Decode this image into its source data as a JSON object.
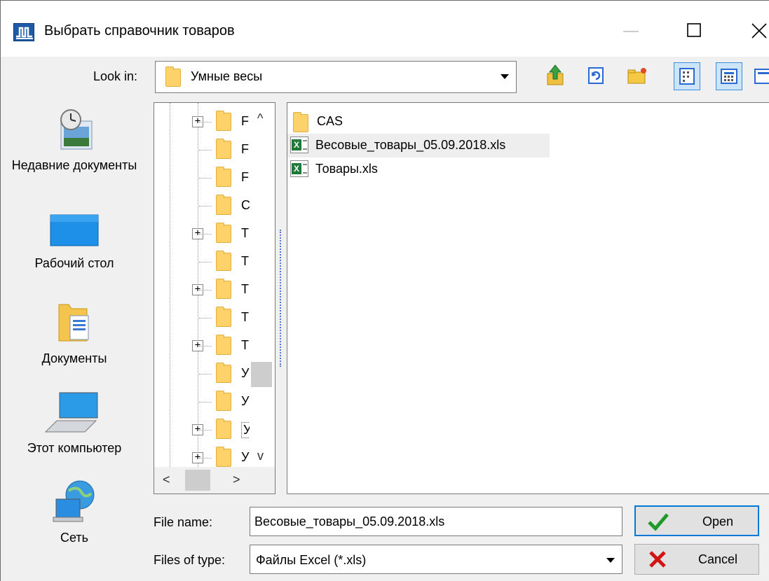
{
  "window": {
    "title": "Выбрать справочник товаров",
    "minimize_glyph": "—",
    "maximize_glyph": "☐",
    "close_glyph": "✕"
  },
  "lookin": {
    "label": "Look in:",
    "value": "Умные весы"
  },
  "toolbar": {
    "icons": [
      "up-folder-icon",
      "refresh-icon",
      "new-folder-icon",
      "list-view-icon",
      "details-view-icon"
    ]
  },
  "places": [
    {
      "label": "Недавние документы",
      "icon": "recent-documents-icon"
    },
    {
      "label": "Рабочий стол",
      "icon": "desktop-icon"
    },
    {
      "label": "Документы",
      "icon": "documents-icon"
    },
    {
      "label": "Этот компьютер",
      "icon": "computer-icon"
    },
    {
      "label": "Сеть",
      "icon": "network-icon"
    }
  ],
  "tree": {
    "items": [
      {
        "label": "F",
        "expandable": true
      },
      {
        "label": "F",
        "expandable": false
      },
      {
        "label": "F",
        "expandable": false
      },
      {
        "label": "C",
        "expandable": false
      },
      {
        "label": "T",
        "expandable": true
      },
      {
        "label": "T",
        "expandable": false
      },
      {
        "label": "T",
        "expandable": true
      },
      {
        "label": "T",
        "expandable": false
      },
      {
        "label": "T",
        "expandable": true
      },
      {
        "label": "У",
        "expandable": false
      },
      {
        "label": "У",
        "expandable": false
      },
      {
        "label": "У",
        "expandable": true
      },
      {
        "label": "У",
        "expandable": true
      }
    ],
    "scroll_up": "^",
    "scroll_down": "v",
    "scroll_left": "<",
    "scroll_right": ">"
  },
  "files": [
    {
      "name": "CAS",
      "type": "folder",
      "selected": false
    },
    {
      "name": "Весовые_товары_05.09.2018.xls",
      "type": "xls",
      "selected": true
    },
    {
      "name": "Товары.xls",
      "type": "xls",
      "selected": false
    }
  ],
  "bottom": {
    "filename_label": "File name:",
    "filename_value": "Весовые_товары_05.09.2018.xls",
    "filetype_label": "Files of type:",
    "filetype_value": "Файлы Excel (*.xls)",
    "open_label": "Open",
    "cancel_label": "Cancel"
  },
  "colors": {
    "folder": "#fdd26a",
    "accent": "#0078d7",
    "check": "#1f9a2a",
    "cancel_x": "#d21414"
  }
}
